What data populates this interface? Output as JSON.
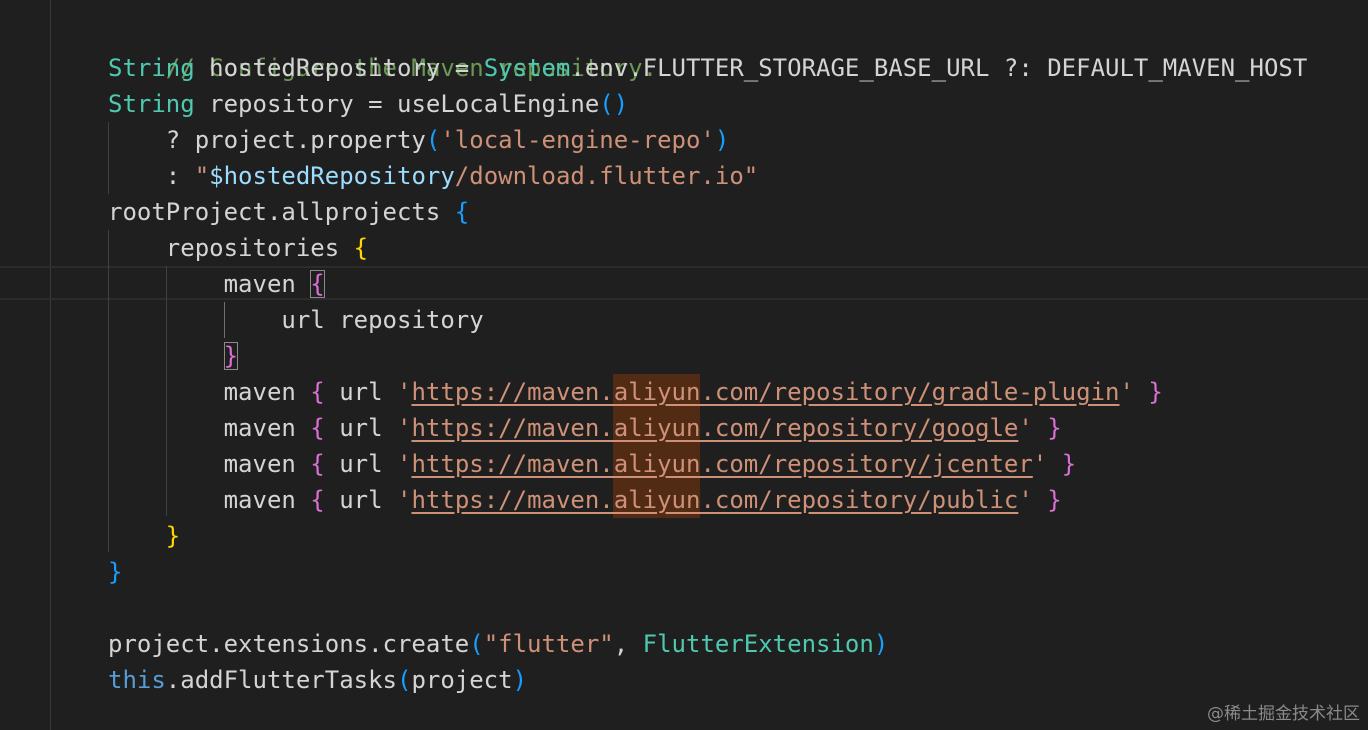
{
  "code": {
    "comment": "// Configure the Maven repository.",
    "l2_type": "String",
    "l2_text": " hostedRepository = ",
    "l2_system": "System",
    "l2_rest": ".env.FLUTTER_STORAGE_BASE_URL ?: DEFAULT_MAVEN_HOST",
    "l3_type": "String",
    "l3_text": " repository = useLocalEngine",
    "l3_parens": "()",
    "l4_text": "    ? project.property",
    "l4_open": "(",
    "l4_str": "'local-engine-repo'",
    "l4_close": ")",
    "l5_prefix": "    : ",
    "l5_quote_open": "\"",
    "l5_var": "$hostedRepository",
    "l5_str": "/download.flutter.io\"",
    "l6_text": "rootProject.allprojects ",
    "l6_brace": "{",
    "l7_text": "    repositories ",
    "l7_brace": "{",
    "l8_text": "        maven ",
    "l8_brace": "{",
    "l9_text": "            url repository",
    "l10_indent": "        ",
    "l10_brace": "}",
    "maven_lines": [
      {
        "kw": "maven",
        "url_kw": "url",
        "url": "https://maven.aliyun.com/repository/gradle-plugin"
      },
      {
        "kw": "maven",
        "url_kw": "url",
        "url": "https://maven.aliyun.com/repository/google"
      },
      {
        "kw": "maven",
        "url_kw": "url",
        "url": "https://maven.aliyun.com/repository/jcenter"
      },
      {
        "kw": "maven",
        "url_kw": "url",
        "url": "https://maven.aliyun.com/repository/public"
      }
    ],
    "l15_brace": "}",
    "l16_brace": "}",
    "l18_text": "project.extensions.create",
    "l18_open": "(",
    "l18_str": "\"flutter\"",
    "l18_comma": ", ",
    "l18_type": "FlutterExtension",
    "l18_close": ")",
    "l19_this": "this",
    "l19_text": ".addFlutterTasks",
    "l19_open": "(",
    "l19_arg": "project",
    "l19_close": ")"
  },
  "watermark": "@稀土掘金技术社区",
  "colors": {
    "background": "#1f1f1f",
    "comment": "#6a9955",
    "type": "#4ec9b0",
    "keyword": "#569cd6",
    "string": "#ce9178",
    "bracket_gold": "#ffd700",
    "bracket_purple": "#da70d6",
    "bracket_blue": "#179fff",
    "search_highlight": "#5c2e14"
  }
}
